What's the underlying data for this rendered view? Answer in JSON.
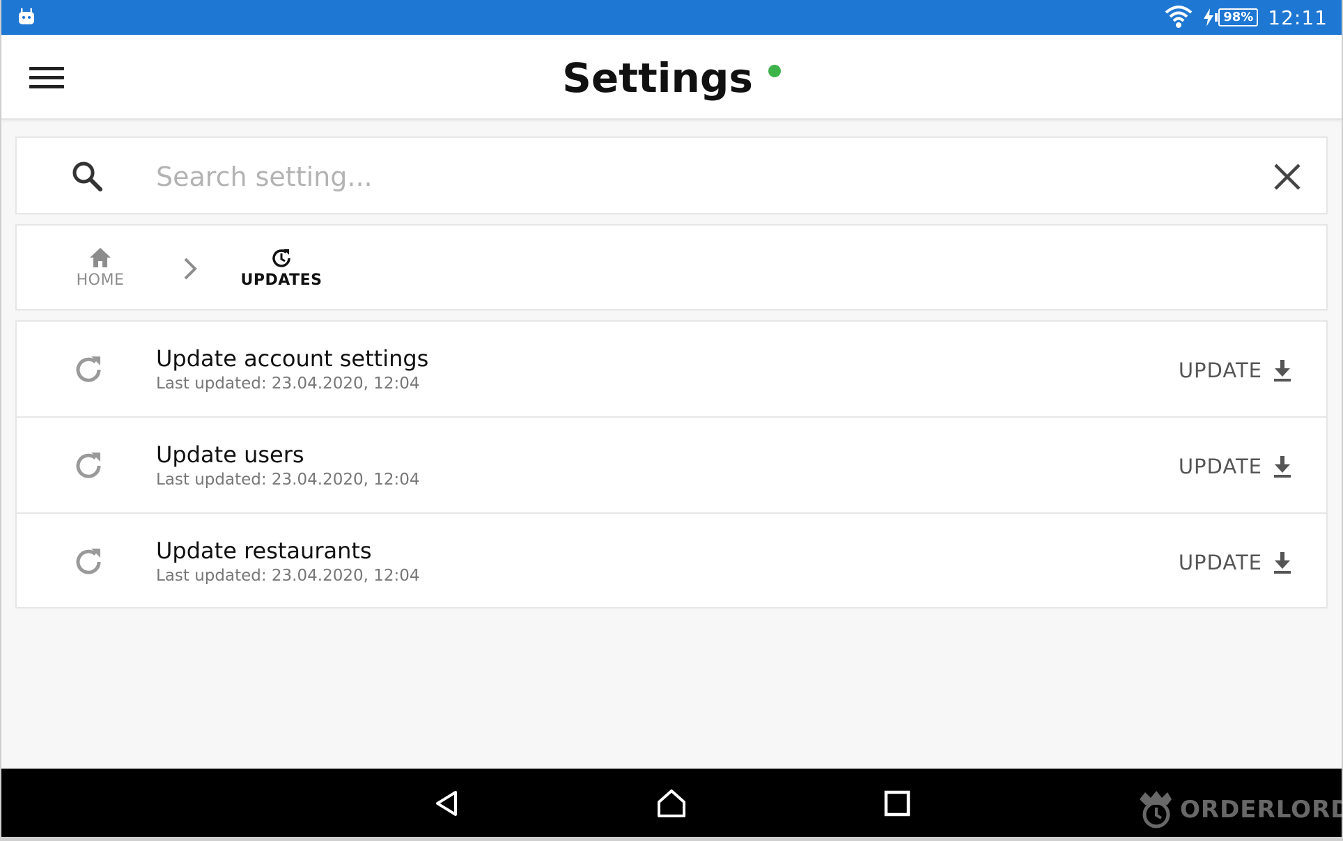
{
  "status_bar": {
    "battery": "98%",
    "time": "12:11"
  },
  "header": {
    "title": "Settings",
    "status_color": "#3db34a"
  },
  "search": {
    "placeholder": "Search setting..."
  },
  "breadcrumb": [
    {
      "label": "HOME",
      "icon": "home-icon"
    },
    {
      "label": "UPDATES",
      "icon": "updates-icon"
    }
  ],
  "updates": [
    {
      "title": "Update account settings",
      "subtitle": "Last updated: 23.04.2020, 12:04",
      "action": "UPDATE"
    },
    {
      "title": "Update users",
      "subtitle": "Last updated: 23.04.2020, 12:04",
      "action": "UPDATE"
    },
    {
      "title": "Update restaurants",
      "subtitle": "Last updated: 23.04.2020, 12:04",
      "action": "UPDATE"
    }
  ],
  "branding": {
    "name": "ORDERLORD"
  },
  "colors": {
    "status_bar": "#1e77d3",
    "accent_green": "#3db34a"
  }
}
